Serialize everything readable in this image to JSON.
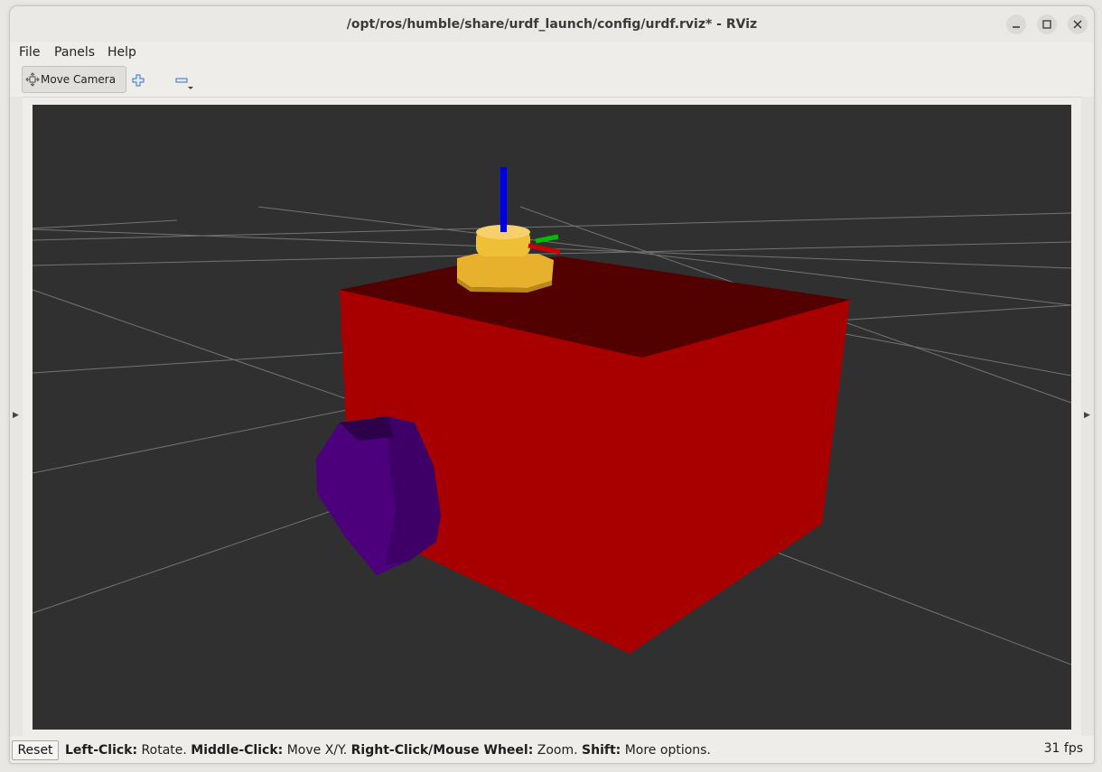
{
  "window": {
    "title": "/opt/ros/humble/share/urdf_launch/config/urdf.rviz* - RViz"
  },
  "menu": {
    "file": "File",
    "panels": "Panels",
    "help": "Help"
  },
  "toolbar": {
    "move_camera": "Move Camera"
  },
  "status": {
    "reset": "Reset",
    "left_click_key": "Left-Click:",
    "left_click_action": " Rotate. ",
    "middle_click_key": "Middle-Click:",
    "middle_click_action": " Move X/Y. ",
    "right_click_key": "Right-Click/Mouse Wheel:",
    "right_click_action": " Zoom. ",
    "shift_key": "Shift:",
    "shift_action": " More options.",
    "fps": "31 fps"
  },
  "scene": {
    "background_color": "#303030",
    "grid_color": "#8a8a8a",
    "body_color": "#aa0000",
    "wheel_color": "#4b0082",
    "sensor_color": "#e8b030",
    "axis_x_color": "#cc0000",
    "axis_y_color": "#00bb00",
    "axis_z_color": "#0000dd"
  }
}
